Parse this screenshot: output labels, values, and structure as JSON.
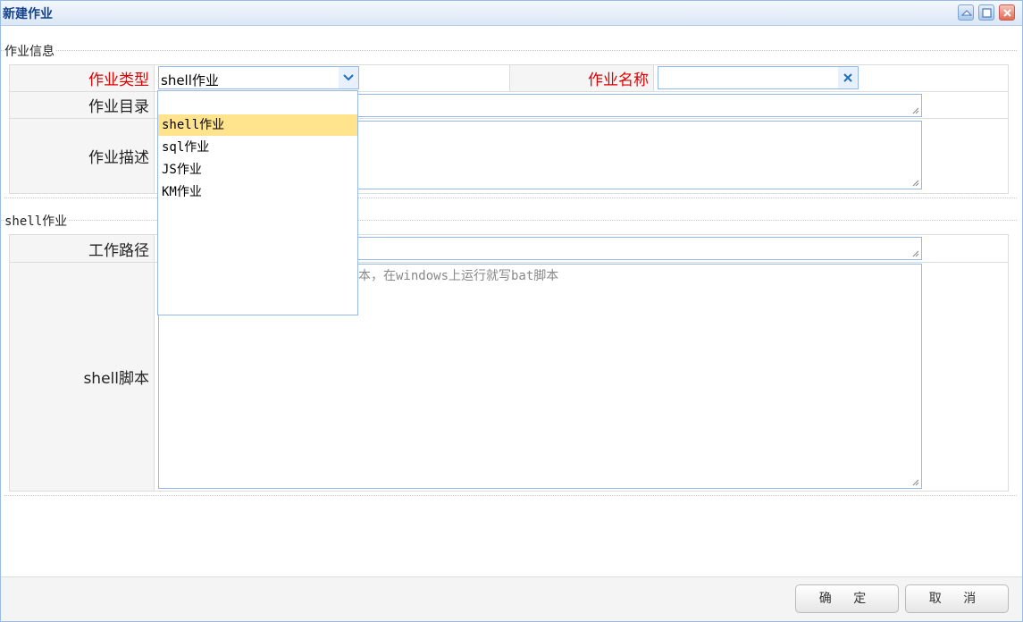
{
  "window": {
    "title": "新建作业"
  },
  "section_job_info": {
    "label": "作业信息"
  },
  "form": {
    "job_type": {
      "label": "作业类型",
      "value": "shell作业"
    },
    "job_name": {
      "label": "作业名称",
      "value": ""
    },
    "job_dir": {
      "label": "作业目录",
      "value": ""
    },
    "job_desc": {
      "label": "作业描述",
      "value": ""
    }
  },
  "dropdown": {
    "options": [
      "shell作业",
      "sql作业",
      "JS作业",
      "KM作业"
    ],
    "selected_index": 0
  },
  "section_shell": {
    "label": "shell作业"
  },
  "shell": {
    "work_path": {
      "label": "工作路径",
      "value": ""
    },
    "script": {
      "label": "shell脚本",
      "placeholder_visible": "本，在windows上运行就写bat脚本"
    }
  },
  "footer": {
    "ok_label": "确 定",
    "cancel_label": "取 消"
  },
  "colors": {
    "required_label": "#e00000",
    "border_accent": "#95b8e7",
    "highlight": "#ffe48d"
  }
}
